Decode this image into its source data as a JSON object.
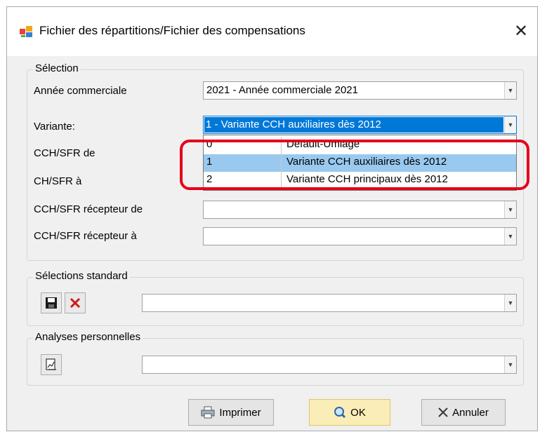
{
  "window": {
    "title": "Fichier des répartitions/Fichier des compensations",
    "close_glyph": "✕"
  },
  "selection": {
    "group_title": "Sélection",
    "annee_label": "Année commerciale",
    "annee_value": "2021 - Année commerciale 2021",
    "variante_label": "Variante:",
    "variante_value": "1 - Variante CCH auxiliaires dès 2012",
    "cch_de_label": "CCH/SFR de",
    "ch_a_label": "CH/SFR à",
    "recepteur_de_label": "CCH/SFR récepteur de",
    "recepteur_a_label": "CCH/SFR récepteur à",
    "recepteur_de_value": "",
    "recepteur_a_value": ""
  },
  "variante_dropdown": {
    "options": [
      {
        "code": "0",
        "name": "Default-Umlage"
      },
      {
        "code": "1",
        "name": "Variante CCH auxiliaires dès 2012"
      },
      {
        "code": "2",
        "name": "Variante CCH principaux dès 2012"
      }
    ],
    "highlighted_index": 1
  },
  "standard": {
    "group_title": "Sélections standard",
    "value": ""
  },
  "personal": {
    "group_title": "Analyses personnelles",
    "value": ""
  },
  "buttons": {
    "print": "Imprimer",
    "ok": "OK",
    "cancel": "Annuler"
  },
  "colors": {
    "selection_blue": "#0078d7",
    "highlight_row": "#99c9ef",
    "annotation_red": "#e4001b",
    "ok_button": "#fbedb7"
  }
}
